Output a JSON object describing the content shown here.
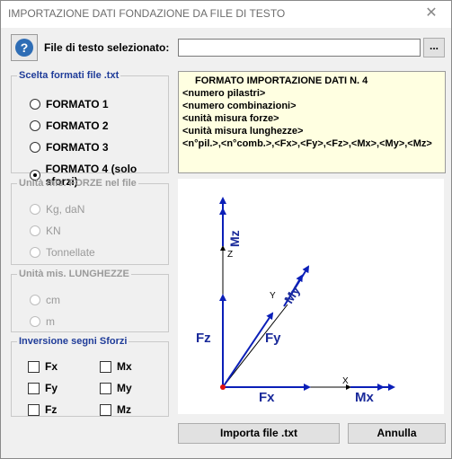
{
  "window": {
    "title": "IMPORTAZIONE DATI FONDAZIONE DA FILE DI TESTO",
    "close_symbol": "✕"
  },
  "file": {
    "help_symbol": "?",
    "label": "File di testo selezionato:",
    "value": "",
    "browse_label": "..."
  },
  "formats": {
    "legend": "Scelta formati file .txt",
    "options": [
      {
        "label": "FORMATO 1",
        "selected": false
      },
      {
        "label": "FORMATO 2",
        "selected": false
      },
      {
        "label": "FORMATO 3",
        "selected": false
      },
      {
        "label": "FORMATO 4 (solo sforzi)",
        "selected": true
      }
    ]
  },
  "format_description": {
    "heading": "FORMATO IMPORTAZIONE DATI N.  4",
    "lines": [
      "<numero pilastri>",
      "<numero combinazioni>",
      "<unità misura forze>",
      "<unità misura lunghezze>",
      "<n°pil.>,<n°comb.>,<Fx>,<Fy>,<Fz>,<Mx>,<My>,<Mz>"
    ]
  },
  "force_units": {
    "legend": "Unità mis. FORZE nel file",
    "options": [
      "Kg, daN",
      "KN",
      "Tonnellate"
    ]
  },
  "length_units": {
    "legend": "Unità mis. LUNGHEZZE",
    "options": [
      "cm",
      "m"
    ]
  },
  "sign_inversion": {
    "legend": "Inversione segni Sforzi",
    "items": [
      "Fx",
      "Mx",
      "Fy",
      "My",
      "Fz",
      "Mz"
    ]
  },
  "diagram": {
    "axis_x": "X",
    "axis_y": "Y",
    "axis_z": "Z",
    "force_x": "Fx",
    "force_y": "Fy",
    "force_z": "Fz",
    "moment_x": "Mx",
    "moment_y": "My",
    "moment_z": "Mz",
    "colors": {
      "axis": "#0b1fb8",
      "label": "#1a2a9a",
      "origin": "#e01010"
    }
  },
  "buttons": {
    "import": "Importa file .txt",
    "cancel": "Annulla"
  }
}
